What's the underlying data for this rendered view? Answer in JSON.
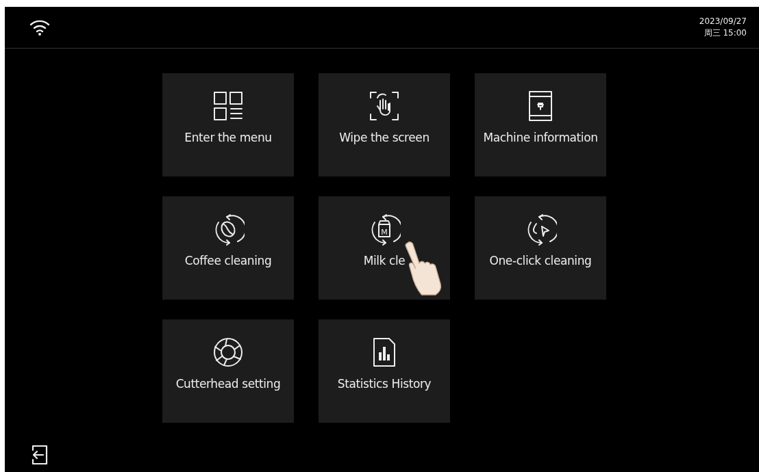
{
  "status_bar": {
    "date": "2023/09/27",
    "weekday_time": "周三  15:00"
  },
  "tiles": [
    {
      "kind": "menu",
      "label": "Enter the menu"
    },
    {
      "kind": "wipe",
      "label": "Wipe the screen"
    },
    {
      "kind": "machine",
      "label": "Machine information"
    },
    {
      "kind": "coffee",
      "label": "Coffee  cleaning"
    },
    {
      "kind": "milk",
      "label": "Milk cle",
      "icon_text": "M"
    },
    {
      "kind": "oneclick",
      "label": "One-click cleaning"
    },
    {
      "kind": "cutterhead",
      "label": "Cutterhead setting"
    },
    {
      "kind": "stats",
      "label": "Statistics History"
    }
  ]
}
